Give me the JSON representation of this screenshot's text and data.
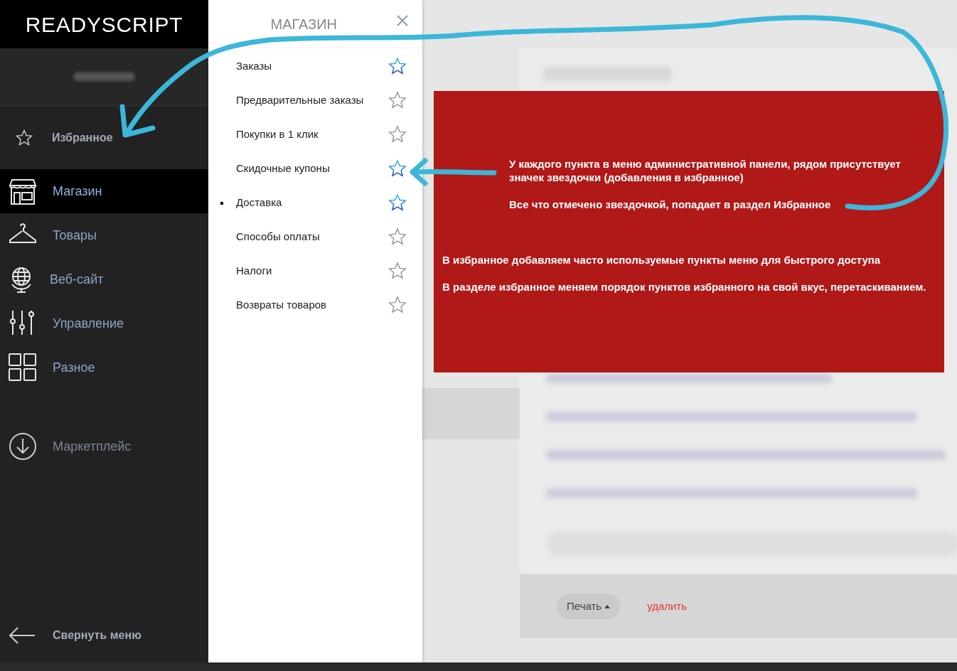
{
  "sidebar": {
    "logo": "READYSCRIPT",
    "favorites": {
      "label": "Избранное"
    },
    "items": [
      {
        "label": "Магазин",
        "selected": true
      },
      {
        "label": "Товары",
        "selected": false
      },
      {
        "label": "Веб-сайт",
        "selected": false
      },
      {
        "label": "Управление",
        "selected": false
      },
      {
        "label": "Разное",
        "selected": false
      }
    ],
    "marketplace": {
      "label": "Маркетплейс"
    },
    "collapse": {
      "label": "Свернуть меню"
    }
  },
  "submenu": {
    "title": "МАГАЗИН",
    "items": [
      {
        "label": "Заказы",
        "favorite": true,
        "current": false
      },
      {
        "label": "Предварительные заказы",
        "favorite": false,
        "current": false
      },
      {
        "label": "Покупки в 1 клик",
        "favorite": false,
        "current": false
      },
      {
        "label": "Скидочные купоны",
        "favorite": true,
        "current": false
      },
      {
        "label": "Доставка",
        "favorite": true,
        "current": true
      },
      {
        "label": "Способы оплаты",
        "favorite": false,
        "current": false
      },
      {
        "label": "Налоги",
        "favorite": false,
        "current": false
      },
      {
        "label": "Возвраты товаров",
        "favorite": false,
        "current": false
      }
    ]
  },
  "background": {
    "print_button": "Печать",
    "delete_link": "удалить"
  },
  "note": {
    "paragraphs": [
      "У каждого пункта в меню административной панели, рядом присутствует значек звездочки (добавления в избранное)",
      "Все что отмечено звездочкой, попадает в раздел Избранное",
      "В избранное добавляем часто используемые пункты меню для быстрого доступа",
      "В разделе избранное меняем порядок пунктов избранного на свой вкус, перетаскиванием."
    ]
  }
}
